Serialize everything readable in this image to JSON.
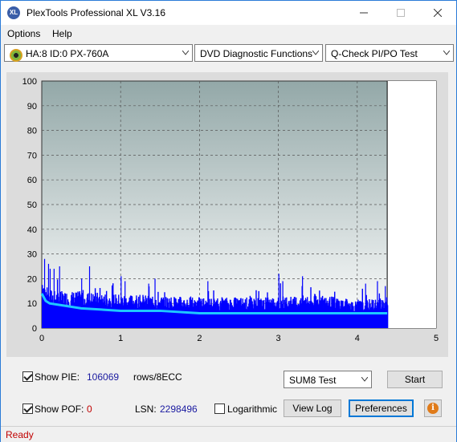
{
  "window": {
    "title": "PlexTools Professional XL V3.16",
    "icon_text": "XL"
  },
  "menu": {
    "items": [
      "Options",
      "Help"
    ]
  },
  "toolbar": {
    "drive": "HA:8 ID:0  PX-760A",
    "function": "DVD Diagnostic Functions",
    "test": "Q-Check PI/PO Test"
  },
  "chart_data": {
    "type": "area",
    "xlim": [
      0,
      5
    ],
    "ylim": [
      0,
      100
    ],
    "x_ticks": [
      "0",
      "1",
      "2",
      "3",
      "4",
      "5"
    ],
    "y_ticks": [
      "0",
      "10",
      "20",
      "30",
      "40",
      "50",
      "60",
      "70",
      "80",
      "90",
      "100"
    ],
    "grid": true,
    "end_marker_x": 4.38,
    "series": [
      {
        "values_approx": {
          "x": [
            0,
            0.05,
            0.2,
            0.5,
            1.0,
            2.0,
            3.0,
            3.5,
            4.0,
            4.38
          ],
          "y": [
            18,
            13,
            12,
            12,
            11,
            10,
            10,
            11,
            9,
            10
          ]
        },
        "peaks_x": [
          0.03,
          0.08,
          0.1,
          0.15,
          0.22,
          0.5,
          0.6,
          1.0,
          1.05,
          1.35,
          1.43,
          2.1,
          3.0,
          3.05,
          3.3,
          4.1,
          4.25,
          4.35
        ],
        "peaks_y": [
          28,
          26,
          24,
          24,
          25,
          20,
          25,
          21,
          19,
          18,
          20,
          19,
          22,
          19,
          21,
          18,
          19,
          17
        ]
      },
      {
        "x": [
          0,
          0.05,
          0.1,
          0.3,
          0.5,
          1.0,
          1.5,
          2.0,
          2.5,
          3.0,
          3.5,
          4.0,
          4.38
        ],
        "y": [
          14,
          11,
          10,
          9,
          8,
          7,
          7,
          6,
          6,
          6,
          6,
          6,
          6
        ]
      }
    ],
    "colors": {
      "bars": "#0000ff",
      "line": "#1ec8ff",
      "plot_bg_top": "#93a8a8",
      "plot_bg_bottom": "#ffffff"
    }
  },
  "controls": {
    "show_pie_label": "Show PIE:",
    "pie_value": "106069",
    "pie_unit": "rows/8ECC",
    "show_pof_label": "Show POF:",
    "pof_value": "0",
    "lsn_label": "LSN:",
    "lsn_value": "2298496",
    "logarithmic_label": "Logarithmic",
    "test_select": "SUM8 Test",
    "start_label": "Start",
    "view_log_label": "View Log",
    "preferences_label": "Preferences",
    "show_pie_checked": true,
    "show_pof_checked": true,
    "logarithmic_checked": false
  },
  "status": {
    "text": "Ready"
  }
}
